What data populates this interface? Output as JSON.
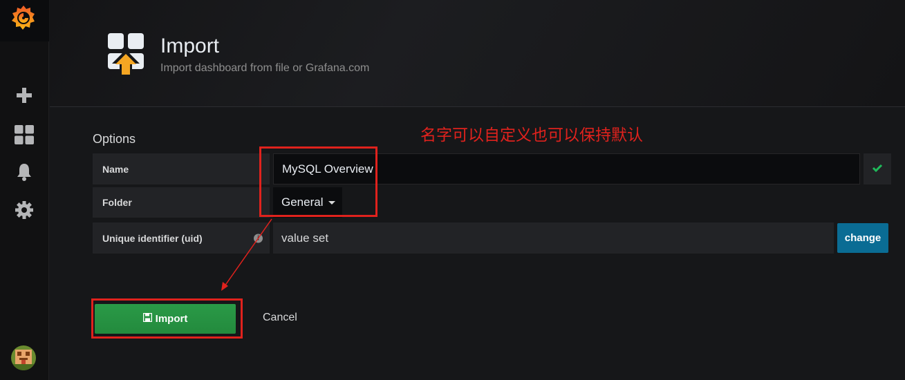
{
  "header": {
    "title": "Import",
    "subtitle": "Import dashboard from file or Grafana.com"
  },
  "options": {
    "title": "Options",
    "rows": [
      {
        "label": "Name",
        "value": "MySQL Overview"
      },
      {
        "label": "Folder",
        "value": "General"
      },
      {
        "label": "Unique identifier (uid)",
        "value": "value set"
      }
    ],
    "change_label": "change"
  },
  "actions": {
    "import_label": "Import",
    "cancel_label": "Cancel"
  },
  "annotation": {
    "text": "名字可以自定义也可以保持默认"
  },
  "colors": {
    "accent_red": "#e0221d",
    "import_green": "#2a9a47",
    "change_blue": "#0a6c94",
    "valid_green": "#1fb95a"
  },
  "icons": {
    "logo": "grafana-logo-icon",
    "sidebar": [
      "plus-icon",
      "dashboards-icon",
      "bell-icon",
      "gear-icon"
    ],
    "header": "dashboard-import-icon",
    "valid": "check-icon",
    "info": "info-icon",
    "save": "save-icon"
  }
}
